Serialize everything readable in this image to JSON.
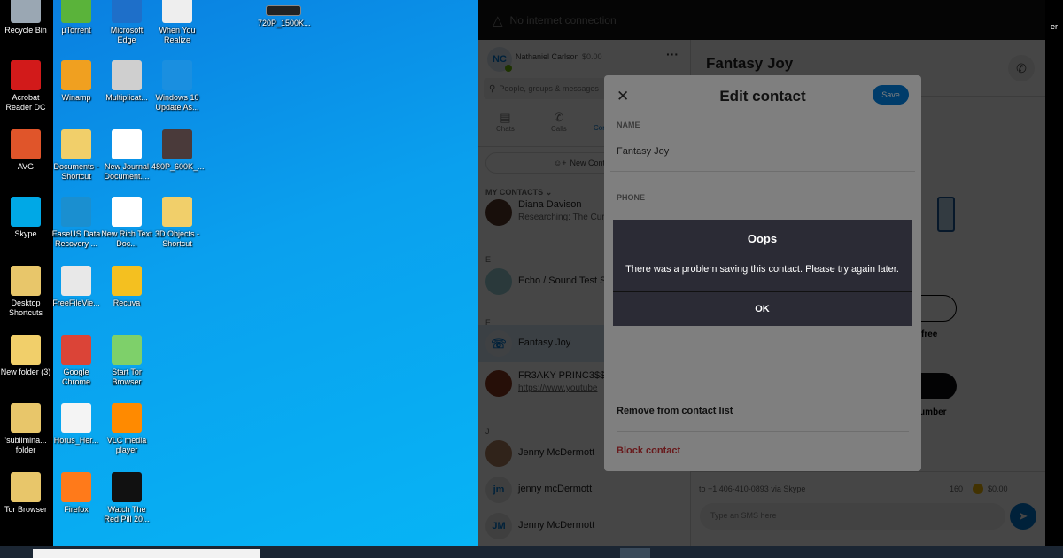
{
  "desktop": {
    "icons": [
      {
        "label": "Recycle Bin",
        "col": 0,
        "row": 0,
        "color": "#9aa7b3"
      },
      {
        "label": "Acrobat Reader DC",
        "col": 0,
        "row": 1,
        "color": "#d21a1a"
      },
      {
        "label": "AVG",
        "col": 0,
        "row": 2,
        "color": "#e0552a"
      },
      {
        "label": "Skype",
        "col": 0,
        "row": 3,
        "color": "#00a8e6"
      },
      {
        "label": "Desktop Shortcuts",
        "col": 0,
        "row": 4,
        "color": "#e8c66a"
      },
      {
        "label": "New folder (3)",
        "col": 0,
        "row": 5,
        "color": "#f1cf6a"
      },
      {
        "label": "'sublimina... folder",
        "col": 0,
        "row": 6,
        "color": "#e8c66a"
      },
      {
        "label": "Tor Browser",
        "col": 0,
        "row": 7,
        "color": "#e8c66a"
      },
      {
        "label": "µTorrent",
        "col": 1,
        "row": 0,
        "color": "#5ab33a"
      },
      {
        "label": "Winamp",
        "col": 1,
        "row": 1,
        "color": "#f0a020"
      },
      {
        "label": "Documents - Shortcut",
        "col": 1,
        "row": 2,
        "color": "#f1cf6a"
      },
      {
        "label": "EaseUS Data Recovery ...",
        "col": 1,
        "row": 3,
        "color": "#1a8fd0"
      },
      {
        "label": "FreeFileVie...",
        "col": 1,
        "row": 4,
        "color": "#e8e8e8"
      },
      {
        "label": "Google Chrome",
        "col": 1,
        "row": 5,
        "color": "#db4437"
      },
      {
        "label": "Horus_Her...",
        "col": 1,
        "row": 6,
        "color": "#f4f4f4"
      },
      {
        "label": "Firefox",
        "col": 1,
        "row": 7,
        "color": "#ff7a1a"
      },
      {
        "label": "Microsoft Edge",
        "col": 2,
        "row": 0,
        "color": "#1e6fc9"
      },
      {
        "label": "Multiplicat...",
        "col": 2,
        "row": 1,
        "color": "#cfcfcf"
      },
      {
        "label": "New Journal Document....",
        "col": 2,
        "row": 2,
        "color": "#ffffff"
      },
      {
        "label": "New Rich Text Doc...",
        "col": 2,
        "row": 3,
        "color": "#ffffff"
      },
      {
        "label": "Recuva",
        "col": 2,
        "row": 4,
        "color": "#f4c020"
      },
      {
        "label": "Start Tor Browser",
        "col": 2,
        "row": 5,
        "color": "#7ed06a"
      },
      {
        "label": "VLC media player",
        "col": 2,
        "row": 6,
        "color": "#ff8a00"
      },
      {
        "label": "Watch The Red Pill 20...",
        "col": 2,
        "row": 7,
        "color": "#111111"
      },
      {
        "label": "When You Realize",
        "col": 3,
        "row": 0,
        "color": "#eeeeee"
      },
      {
        "label": "Windows 10 Update As...",
        "col": 3,
        "row": 1,
        "color": "#1a8fe0"
      },
      {
        "label": "480P_600K_...",
        "col": 3,
        "row": 2,
        "color": "#4a3a3a"
      },
      {
        "label": "3D Objects - Shortcut",
        "col": 3,
        "row": 3,
        "color": "#f1cf6a"
      }
    ],
    "extra_icon": {
      "label": "720P_1500K..."
    },
    "edge_text": "er"
  },
  "skype": {
    "status_bar": "No internet connection",
    "profile": {
      "initials": "NC",
      "name": "Nathaniel Carlson",
      "balance": "$0.00",
      "more": "···"
    },
    "search_placeholder": "People, groups & messages",
    "tabs": [
      {
        "label": "Chats"
      },
      {
        "label": "Calls"
      },
      {
        "label": "Contacts"
      }
    ],
    "new_contact": "New Contact",
    "contacts_header": "MY CONTACTS",
    "contacts": [
      {
        "section": "",
        "name": "Diana Davison",
        "sub": "Researching: The Cur",
        "initials": ""
      },
      {
        "section": "E",
        "name": "Echo / Sound Test Service",
        "sub": "",
        "initials": ""
      },
      {
        "section": "F",
        "name": "Fantasy Joy",
        "sub": "",
        "initials": "",
        "selected": true
      },
      {
        "section": "",
        "name": "FR3AKY PRINC3$$",
        "sub": "https://www.youtube",
        "initials": ""
      },
      {
        "section": "J",
        "name": "Jenny McDermott",
        "sub": "",
        "initials": ""
      },
      {
        "section": "",
        "name": "jenny mcDermott",
        "sub": "",
        "initials": "jm"
      },
      {
        "section": "",
        "name": "Jenny McDermott",
        "sub": "",
        "initials": "JM"
      }
    ],
    "chat": {
      "title": "Fantasy Joy",
      "promo_fragment_1": "free",
      "promo_fragment_2": "umber",
      "sms_to": "to +1 406-410-0893 via Skype",
      "char_count": "160",
      "credit": "$0.00",
      "sms_placeholder": "Type an SMS here"
    },
    "edit_dialog": {
      "title": "Edit contact",
      "save": "Save",
      "name_label": "NAME",
      "name_value": "Fantasy Joy",
      "phone_label": "PHONE",
      "remove": "Remove from contact list",
      "block": "Block contact"
    },
    "error_dialog": {
      "title": "Oops",
      "message": "There was a problem saving this contact. Please try again later.",
      "ok": "OK"
    }
  },
  "colors": {
    "accent": "#0078d4",
    "danger": "#c4262e",
    "modal_bg": "#2b2b35"
  }
}
